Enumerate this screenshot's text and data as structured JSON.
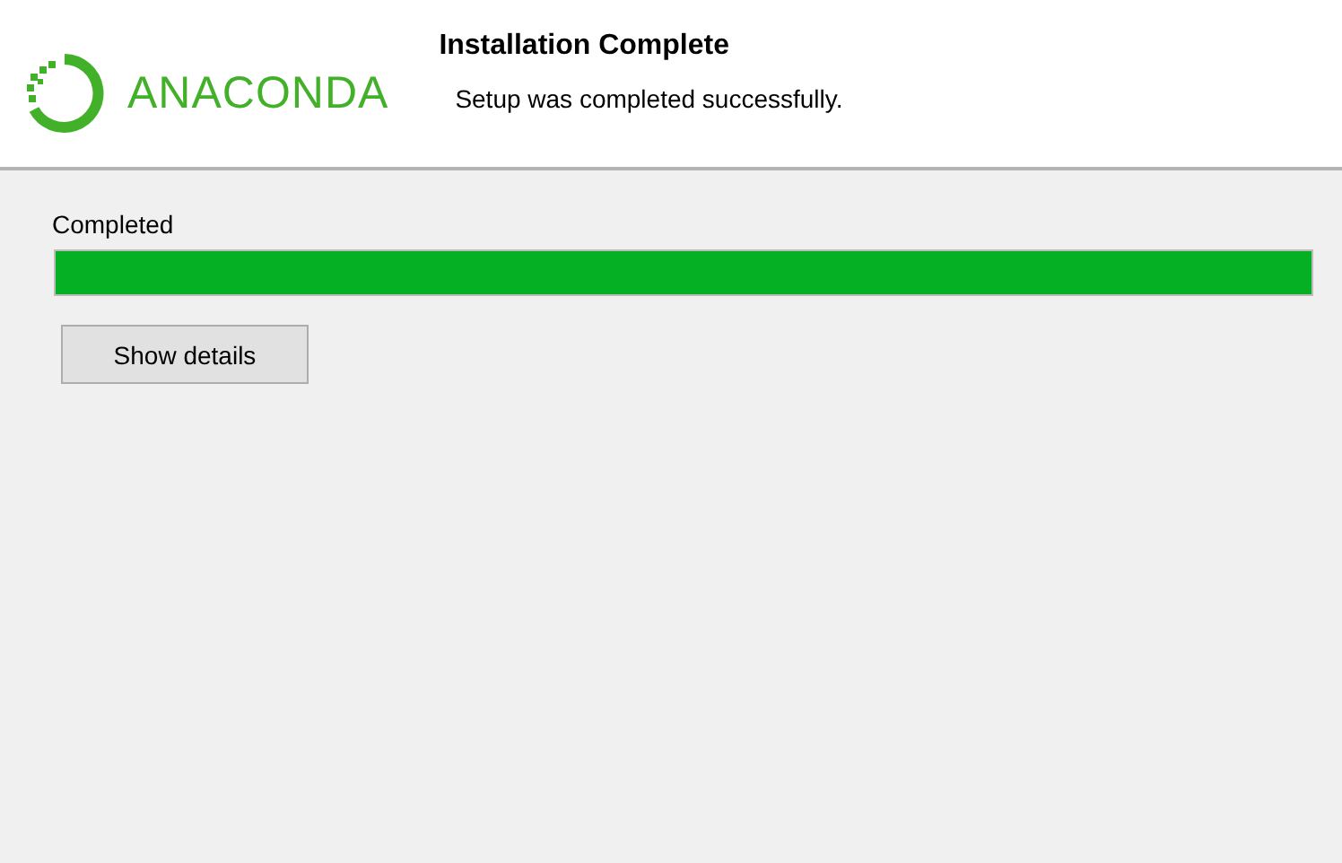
{
  "header": {
    "logo_text": "ANACONDA",
    "title": "Installation Complete",
    "subtitle": "Setup was completed successfully."
  },
  "progress": {
    "label": "Completed",
    "level": 1
  },
  "buttons": [
    {
      "label": "Show details"
    }
  ]
}
